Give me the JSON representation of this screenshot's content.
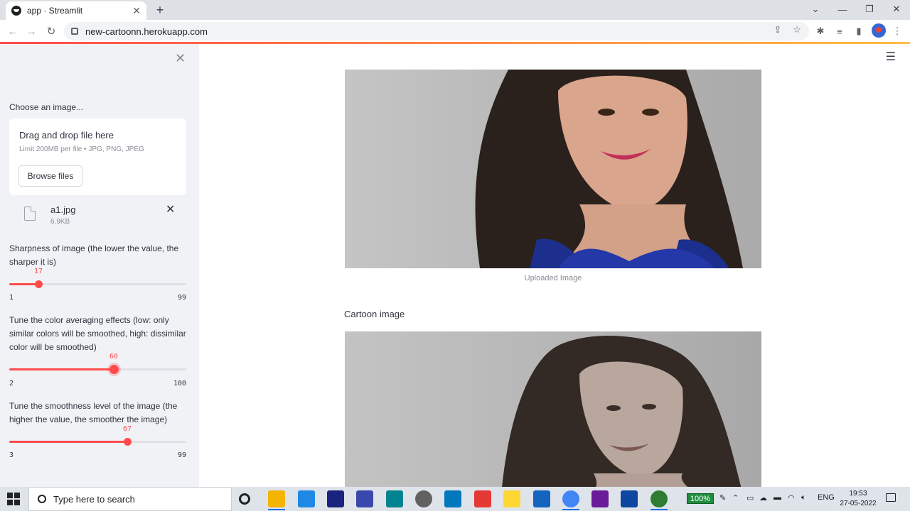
{
  "browser": {
    "tab_title": "app · Streamlit",
    "url": "new-cartoonn.herokuapp.com",
    "new_tab_label": "+",
    "tab_close": "✕"
  },
  "sidebar": {
    "close_label": "✕",
    "uploader_label": "Choose an image...",
    "dropzone_text": "Drag and drop file here",
    "limit_text": "Limit 200MB per file • JPG, PNG, JPEG",
    "browse_label": "Browse files",
    "file": {
      "name": "a1.jpg",
      "size": "6.9KB"
    },
    "sliders": [
      {
        "label": "Sharpness of image (the lower the value, the sharper it is)",
        "value": 17,
        "min": 1,
        "max": 99
      },
      {
        "label": "Tune the color averaging effects (low: only similar colors will be smoothed, high: dissimilar color will be smoothed)",
        "value": 60,
        "min": 2,
        "max": 100
      },
      {
        "label": "Tune the smoothness level of the image (the higher the value, the smoother the image)",
        "value": 67,
        "min": 3,
        "max": 99
      }
    ]
  },
  "main": {
    "menu_icon": "☰",
    "uploaded_caption": "Uploaded Image",
    "cartoon_title": "Cartoon image"
  },
  "taskbar": {
    "search_placeholder": "Type here to search",
    "battery": "100%",
    "language": "ENG",
    "time": "19:53",
    "date": "27-05-2022",
    "accent": "#ff4b4b"
  }
}
